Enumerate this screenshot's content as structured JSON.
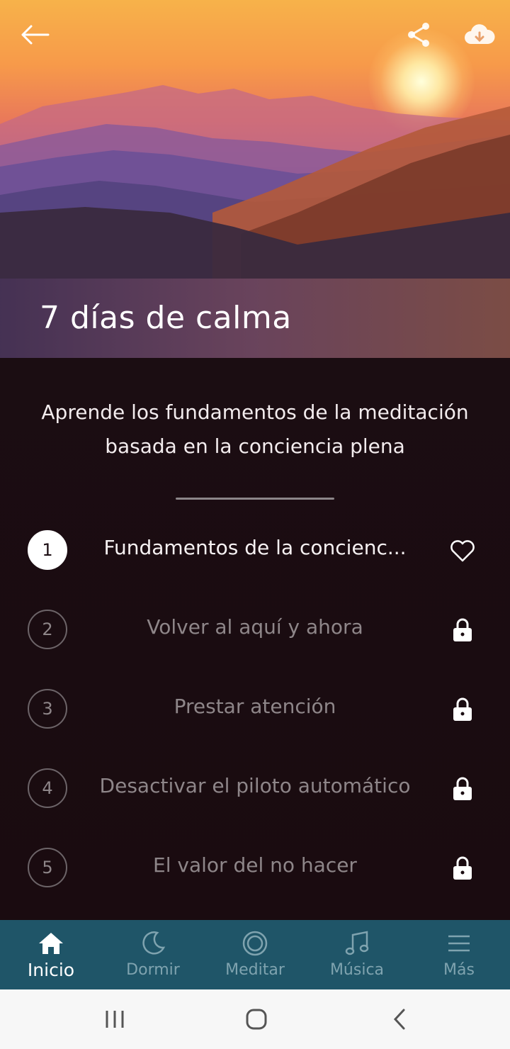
{
  "header": {
    "title": "7 días de calma",
    "back_icon": "arrow-left-icon",
    "share_icon": "share-icon",
    "download_icon": "cloud-download-icon"
  },
  "description": {
    "line1": "Aprende los fundamentos de la meditación",
    "line2": "basada en la conciencia plena"
  },
  "lessons": [
    {
      "number": "1",
      "title": "Fundamentos de la concienc...",
      "icon": "heart-icon",
      "active": true
    },
    {
      "number": "2",
      "title": "Volver al aquí y ahora",
      "icon": "lock-icon",
      "active": false
    },
    {
      "number": "3",
      "title": "Prestar atención",
      "icon": "lock-icon",
      "active": false
    },
    {
      "number": "4",
      "title": "Desactivar el piloto automático",
      "icon": "lock-icon",
      "active": false
    },
    {
      "number": "5",
      "title": "El valor del no hacer",
      "icon": "lock-icon",
      "active": false
    }
  ],
  "tabbar": {
    "tabs": [
      {
        "label": "Inicio",
        "icon": "home-icon",
        "active": true
      },
      {
        "label": "Dormir",
        "icon": "moon-icon",
        "active": false
      },
      {
        "label": "Meditar",
        "icon": "circle-icon",
        "active": false
      },
      {
        "label": "Música",
        "icon": "music-note-icon",
        "active": false
      },
      {
        "label": "Más",
        "icon": "menu-icon",
        "active": false
      }
    ]
  },
  "colors": {
    "tabbar_bg": "#1f5568",
    "content_bg": "#1b0d12",
    "text_primary": "#ffffff",
    "text_muted": "#8e8689"
  }
}
